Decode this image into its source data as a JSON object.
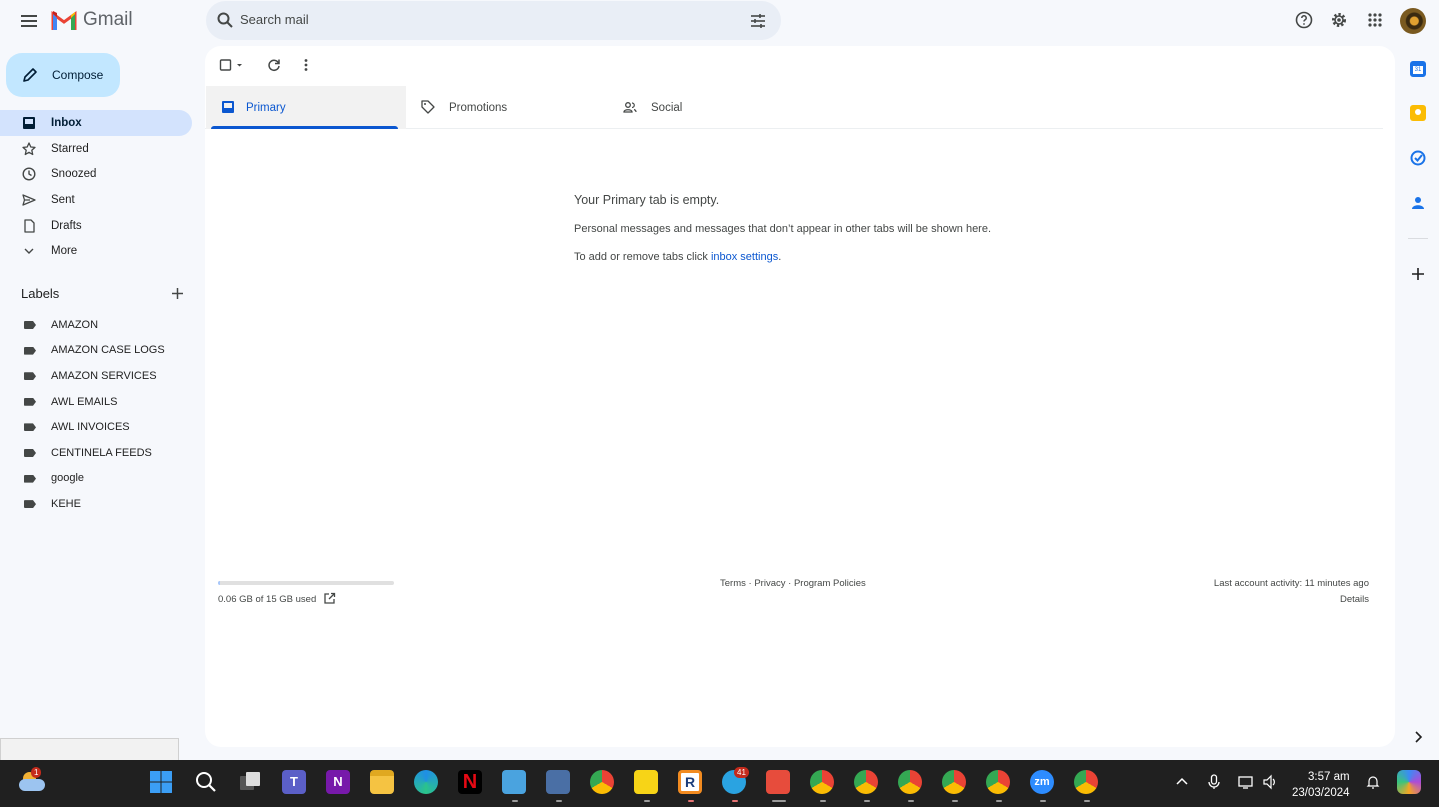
{
  "app": {
    "name": "Gmail"
  },
  "search": {
    "placeholder": "Search mail"
  },
  "compose": {
    "label": "Compose"
  },
  "nav": {
    "items": [
      {
        "label": "Inbox",
        "icon": "inbox-icon",
        "active": true
      },
      {
        "label": "Starred",
        "icon": "star-icon"
      },
      {
        "label": "Snoozed",
        "icon": "clock-icon"
      },
      {
        "label": "Sent",
        "icon": "send-icon"
      },
      {
        "label": "Drafts",
        "icon": "draft-icon"
      },
      {
        "label": "More",
        "icon": "chevron-down-icon"
      }
    ]
  },
  "labels": {
    "heading": "Labels",
    "items": [
      "AMAZON",
      "AMAZON CASE LOGS",
      "AMAZON SERVICES",
      "AWL EMAILS",
      "AWL INVOICES",
      "CENTINELA FEEDS",
      "google",
      "KEHE"
    ]
  },
  "tabs": [
    {
      "label": "Primary",
      "icon": "inbox-icon",
      "active": true
    },
    {
      "label": "Promotions",
      "icon": "tag-icon"
    },
    {
      "label": "Social",
      "icon": "people-icon"
    }
  ],
  "empty": {
    "title": "Your Primary tab is empty.",
    "line1": "Personal messages and messages that don’t appear in other tabs will be shown here.",
    "line2_prefix": "To add or remove tabs click ",
    "line2_link": "inbox settings",
    "line2_suffix": "."
  },
  "footer": {
    "storage_text": "0.06 GB of 15 GB used",
    "storage_fraction": 0.004,
    "terms": "Terms",
    "privacy": "Privacy",
    "policies": "Program Policies",
    "sep": " · ",
    "activity": "Last account activity: 11 minutes ago",
    "details": "Details"
  },
  "taskbar": {
    "time": "3:57 am",
    "date": "23/03/2024",
    "weather_badge": "1",
    "telegram_badge": "41"
  },
  "colors": {
    "accent": "#0b57d0",
    "compose_bg": "#c2e7ff",
    "active_nav": "#d3e3fd",
    "page_bg": "#f6f8fc"
  }
}
